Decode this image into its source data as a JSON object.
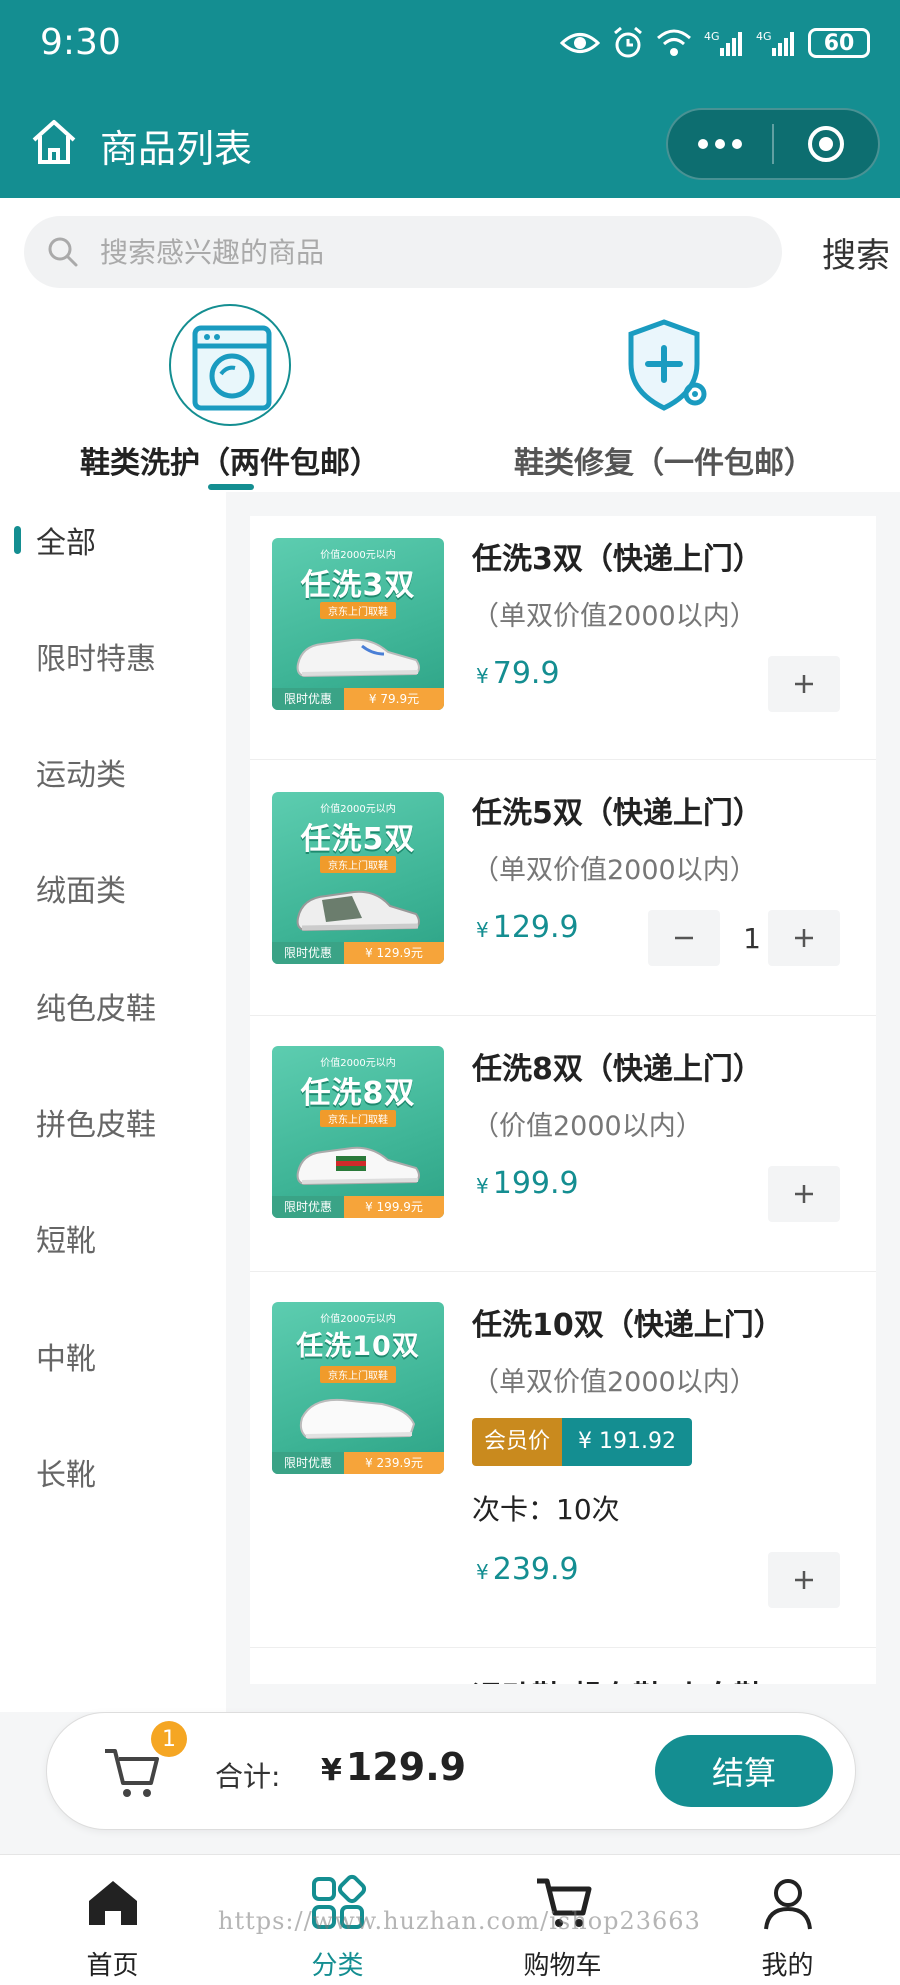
{
  "status_bar": {
    "time": "9:30",
    "network": "4G",
    "battery": "60"
  },
  "nav": {
    "title": "商品列表"
  },
  "search": {
    "placeholder": "搜索感兴趣的商品",
    "button": "搜索"
  },
  "category_tabs": [
    {
      "label": "鞋类洗护（两件包邮）",
      "active": true
    },
    {
      "label": "鞋类修复（一件包邮）",
      "active": false
    }
  ],
  "sidebar": {
    "items": [
      {
        "label": "全部",
        "active": true
      },
      {
        "label": "限时特惠",
        "active": false
      },
      {
        "label": "运动类",
        "active": false
      },
      {
        "label": "绒面类",
        "active": false
      },
      {
        "label": "纯色皮鞋",
        "active": false
      },
      {
        "label": "拼色皮鞋",
        "active": false
      },
      {
        "label": "短靴",
        "active": false
      },
      {
        "label": "中靴",
        "active": false
      },
      {
        "label": "长靴",
        "active": false
      }
    ]
  },
  "products": [
    {
      "title": "任洗3双（快递上门）",
      "desc": "（单双价值2000以内）",
      "price": "79.9",
      "thumb": {
        "top": "价值2000元以内",
        "title": "任洗3双",
        "sub": "京东上门取鞋",
        "tag": "限时优惠",
        "tag_price": "¥ 79.9元"
      },
      "qty": null
    },
    {
      "title": "任洗5双（快递上门）",
      "desc": "（单双价值2000以内）",
      "price": "129.9",
      "thumb": {
        "top": "价值2000元以内",
        "title": "任洗5双",
        "sub": "京东上门取鞋",
        "tag": "限时优惠",
        "tag_price": "¥ 129.9元"
      },
      "qty": "1"
    },
    {
      "title": "任洗8双（快递上门）",
      "desc": "（价值2000以内）",
      "price": "199.9",
      "thumb": {
        "top": "价值2000元以内",
        "title": "任洗8双",
        "sub": "京东上门取鞋",
        "tag": "限时优惠",
        "tag_price": "¥ 199.9元"
      },
      "qty": null
    },
    {
      "title": "任洗10双（快递上门）",
      "desc": "（单双价值2000以内）",
      "price": "239.9",
      "member_label": "会员价",
      "member_price": "¥ 191.92",
      "card_times": "次卡：10次",
      "thumb": {
        "top": "价值2000元以内",
        "title": "任洗10双",
        "sub": "京东上门取鞋",
        "tag": "限时优惠",
        "tag_price": "¥ 239.9元"
      },
      "qty": null
    }
  ],
  "partial_product_title": "运动鞋/帆布鞋/小白鞋",
  "currency_symbol": "¥",
  "cart": {
    "badge": "1",
    "total_label": "合计:",
    "total_value": "129.9",
    "checkout": "结算"
  },
  "tabs": [
    {
      "label": "首页",
      "icon": "home-icon",
      "active": false
    },
    {
      "label": "分类",
      "icon": "category-icon",
      "active": true
    },
    {
      "label": "购物车",
      "icon": "cart-icon",
      "active": false
    },
    {
      "label": "我的",
      "icon": "user-icon",
      "active": false
    }
  ],
  "watermark": "https://www.huzhan.com/ishop23663",
  "colors": {
    "primary": "#148e91",
    "accent": "#f5a623",
    "member": "#c98a1e"
  }
}
